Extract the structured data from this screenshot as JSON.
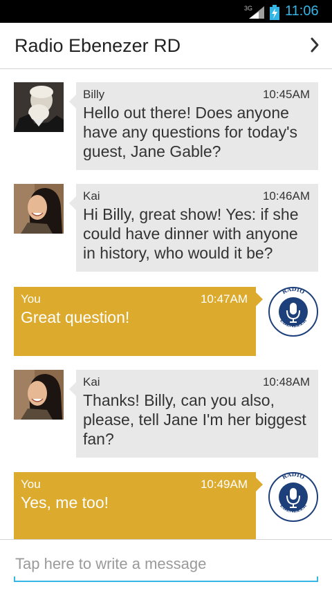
{
  "status_bar": {
    "network": "3G",
    "time": "11:06"
  },
  "header": {
    "title": "Radio Ebenezer RD"
  },
  "messages": [
    {
      "sender": "Billy",
      "time": "10:45AM",
      "text": "Hello out there! Does anyone have any questions for today's guest, Jane Gable?",
      "direction": "incoming"
    },
    {
      "sender": "Kai",
      "time": "10:46AM",
      "text": "Hi Billy, great show! Yes: if she could have dinner with anyone in history, who would it be?",
      "direction": "incoming"
    },
    {
      "sender": "You",
      "time": "10:47AM",
      "text": "Great question!",
      "direction": "outgoing"
    },
    {
      "sender": "Kai",
      "time": "10:48AM",
      "text": "Thanks! Billy, can you also, please, tell Jane I'm her biggest fan?",
      "direction": "incoming"
    },
    {
      "sender": "You",
      "time": "10:49AM",
      "text": "Yes, me too!",
      "direction": "outgoing"
    }
  ],
  "logo": {
    "top_text": "RADIO",
    "bottom_text": "EBENEZER"
  },
  "composer": {
    "placeholder": "Tap here to write a message"
  },
  "colors": {
    "accent": "#33b5e5",
    "outgoing_bubble": "#dcaa2c",
    "incoming_bubble": "#e8e8e8",
    "logo_navy": "#1d3f7a"
  }
}
